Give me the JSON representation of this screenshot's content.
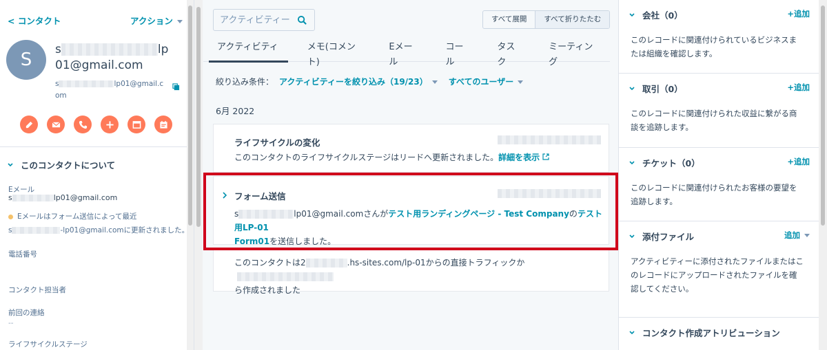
{
  "left": {
    "back_label": "< コンタクト",
    "actions_label": "アクション",
    "avatar_initial": "S",
    "name_prefix": "s",
    "name_suffix": "lp",
    "name_line2": "01@gmail.com",
    "sub_prefix": "s",
    "sub_suffix": "lp01@gmail.c",
    "sub_line2": "om",
    "action_icons": [
      "note-icon",
      "email-icon",
      "call-icon",
      "add-icon",
      "task-icon",
      "meeting-icon"
    ],
    "about_header": "このコンタクトについて",
    "email_label": "Eメール",
    "email_prefix": "s",
    "email_suffix": "lp01@gmail.com",
    "email_note": "Eメールはフォーム送信によって最近",
    "email_note2_prefix": "s",
    "email_note2_suffix": "-lp01@gmail.comに更新されました。",
    "phone_label": "電話番号",
    "owner_label": "コンタクト担当者",
    "last_contact_label": "前回の連絡",
    "last_contact_value": "--",
    "lifecycle_label": "ライフサイクルステージ"
  },
  "center": {
    "search_placeholder": "アクティビティー",
    "expand_all": "すべて展開",
    "collapse_all": "すべて折りたたむ",
    "tabs": [
      "アクティビティー",
      "メモ(コメント)",
      "Eメール",
      "コール",
      "タスク",
      "ミーティング"
    ],
    "filter_label": "絞り込み条件：",
    "filter_activity": "アクティビティーを絞り込み（19/23）",
    "filter_users": "すべてのユーザー",
    "month": "6月 2022",
    "card1": {
      "title": "ライフサイクルの変化",
      "body": "このコンタクトのライフサイクルステージはリードへ更新されました。",
      "link": "詳細を表示"
    },
    "card2": {
      "title": "フォーム送信",
      "prefix": "s",
      "email_suffix": "lp01@gmail.comさんが",
      "page_link": "テスト用ランディングページ - Test Company",
      "connector": "の",
      "form_link_1": "テスト用LP-01",
      "form_link_2": "Form01",
      "tail": "を送信しました。"
    },
    "card3": {
      "prefix": "このコンタクトは2",
      "middle": ".hs-sites.com/lp-01からの直接トラフィックか",
      "line2": "ら作成されました"
    }
  },
  "right": {
    "company_title": "会社（0）",
    "company_add": "+追加",
    "company_text": "このレコードに関連付けられているビジネスまたは組織を確認します。",
    "deal_title": "取引（0）",
    "deal_add": "+追加",
    "deal_text": "このレコードに関連付けられた収益に繋がる商談を追跡します。",
    "ticket_title": "チケット（0）",
    "ticket_add": "+追加",
    "ticket_text": "このレコードに関連付けられたお客様の要望を追跡します。",
    "attach_title": "添付ファイル",
    "attach_add": "追加",
    "attach_text": "アクティビティーに添付されたファイルまたはこのレコードにアップロードされたファイルを確認してください。",
    "attribution_title": "コンタクト作成アトリビューション"
  },
  "colors": {
    "link": "#0091ae",
    "accent": "#ff7a59",
    "highlight": "#d0021b"
  }
}
